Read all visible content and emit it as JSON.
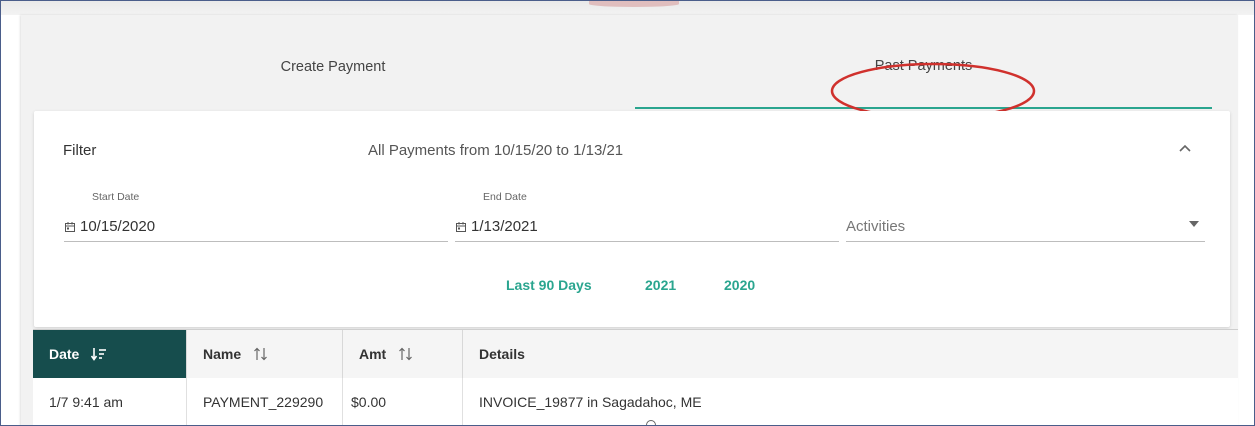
{
  "tabs": [
    {
      "label": "Create Payment",
      "active": false
    },
    {
      "label": "Past Payments",
      "active": true
    }
  ],
  "filter": {
    "title": "Filter",
    "summary": "All Payments from 10/15/20 to 1/13/21",
    "start_date": {
      "label": "Start Date",
      "value": "10/15/2020"
    },
    "end_date": {
      "label": "End Date",
      "value": "1/13/2021"
    },
    "activities": {
      "placeholder": "Activities"
    },
    "quick_ranges": [
      "Last 90 Days",
      "2021",
      "2020"
    ]
  },
  "table": {
    "columns": [
      "Date",
      "Name",
      "Amt",
      "Details"
    ],
    "sorted_column": "Date",
    "rows": [
      {
        "date": "1/7 9:41 am",
        "name": "PAYMENT_229290",
        "amt": "$0.00",
        "details": "INVOICE_19877 in Sagadahoc, ME"
      }
    ]
  },
  "colors": {
    "accent": "#2aa58f",
    "header_active": "#164d4d",
    "highlight_ellipse": "#d0312d"
  },
  "icons": {
    "calendar": "calendar-icon",
    "collapse": "chevron-up-icon",
    "dropdown": "caret-down-icon",
    "sort_active": "sort-descending-icon",
    "sort": "sort-arrows-icon"
  }
}
